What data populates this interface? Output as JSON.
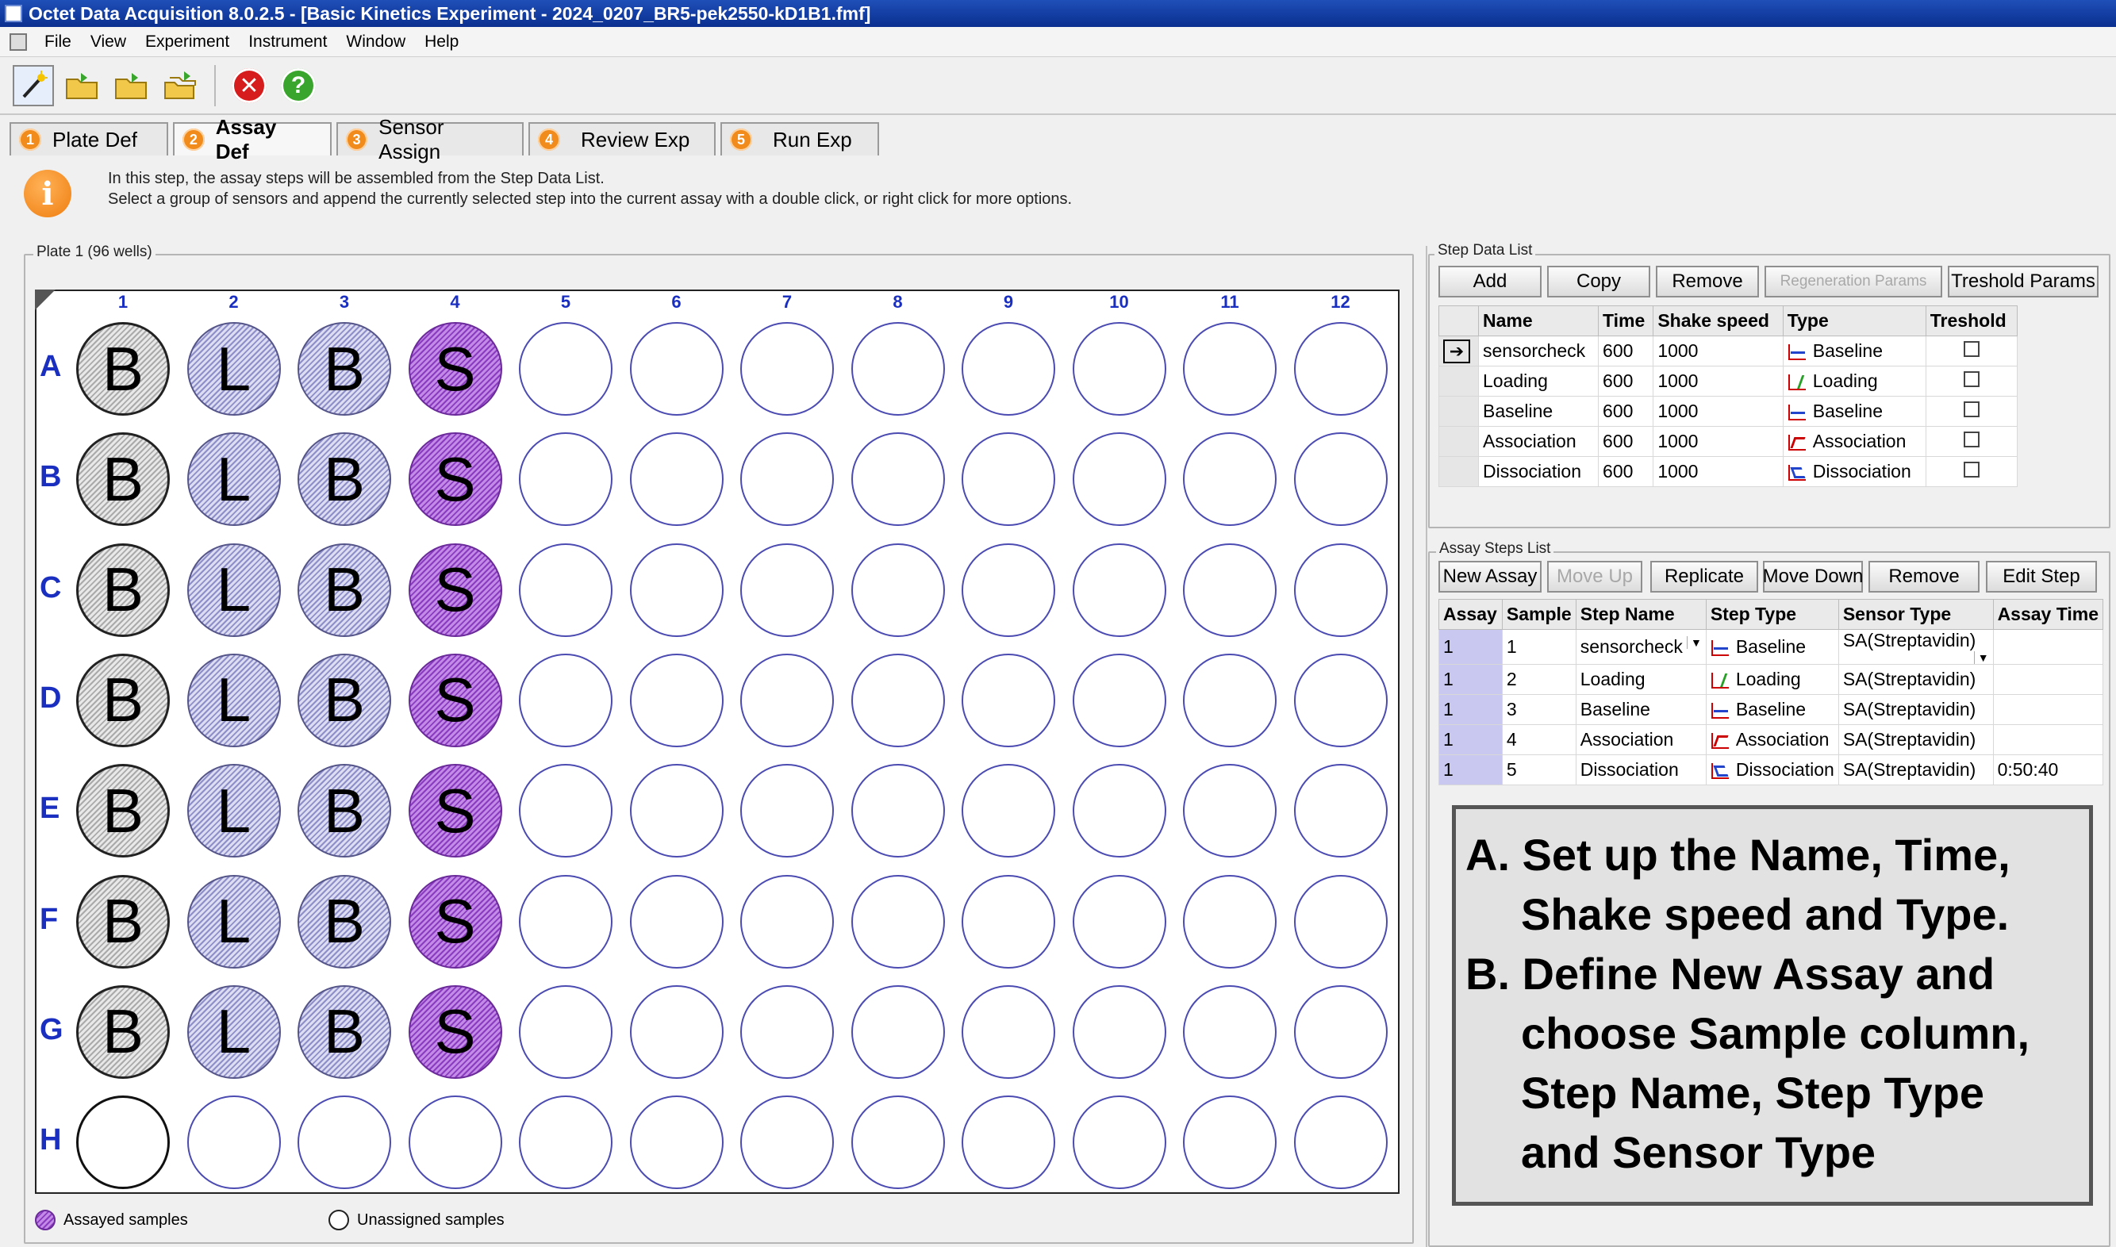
{
  "window": {
    "title": "Octet Data Acquisition 8.0.2.5 - [Basic Kinetics Experiment - 2024_0207_BR5-pek2550-kD1B1.fmf]"
  },
  "menu": [
    "File",
    "View",
    "Experiment",
    "Instrument",
    "Window",
    "Help"
  ],
  "tabs": [
    {
      "num": "1",
      "label": "Plate Def"
    },
    {
      "num": "2",
      "label": "Assay Def"
    },
    {
      "num": "3",
      "label": "Sensor Assign"
    },
    {
      "num": "4",
      "label": "Review Exp"
    },
    {
      "num": "5",
      "label": "Run Exp"
    }
  ],
  "info": {
    "line1": "In this step, the assay steps will be assembled from the Step Data List.",
    "line2": "Select a group of sensors and append the currently selected step into the current assay with a double click, or right click for more options."
  },
  "plate": {
    "group_label": "Plate 1 (96 wells)",
    "columns": [
      "1",
      "2",
      "3",
      "4",
      "5",
      "6",
      "7",
      "8",
      "9",
      "10",
      "11",
      "12"
    ],
    "rows": [
      "A",
      "B",
      "C",
      "D",
      "E",
      "F",
      "G",
      "H"
    ],
    "well_letters": [
      "B",
      "L",
      "B",
      "S"
    ],
    "legend_assayed": "Assayed samples",
    "legend_unassigned": "Unassigned samples"
  },
  "step_data": {
    "group_label": "Step Data List",
    "buttons": [
      "Add",
      "Copy",
      "Remove",
      "Regeneration Params",
      "Treshold Params"
    ],
    "headers": [
      "Name",
      "Time",
      "Shake speed",
      "Type",
      "Treshold"
    ],
    "rows": [
      {
        "name": "sensorcheck",
        "time": "600",
        "speed": "1000",
        "type": "Baseline"
      },
      {
        "name": "Loading",
        "time": "600",
        "speed": "1000",
        "type": "Loading"
      },
      {
        "name": "Baseline",
        "time": "600",
        "speed": "1000",
        "type": "Baseline"
      },
      {
        "name": "Association",
        "time": "600",
        "speed": "1000",
        "type": "Association"
      },
      {
        "name": "Dissociation",
        "time": "600",
        "speed": "1000",
        "type": "Dissociation"
      }
    ]
  },
  "assay_steps": {
    "group_label": "Assay Steps List",
    "buttons": [
      "New Assay",
      "Move Up",
      "Replicate",
      "Move Down",
      "Remove",
      "Edit Step"
    ],
    "headers": [
      "Assay",
      "Sample",
      "Step Name",
      "Step Type",
      "Sensor Type",
      "Assay Time"
    ],
    "rows": [
      {
        "assay": "1",
        "sample": "1",
        "step_name": "sensorcheck",
        "step_type": "Baseline",
        "sensor": "SA(Streptavidin)",
        "time": ""
      },
      {
        "assay": "1",
        "sample": "2",
        "step_name": "Loading",
        "step_type": "Loading",
        "sensor": "SA(Streptavidin)",
        "time": ""
      },
      {
        "assay": "1",
        "sample": "3",
        "step_name": "Baseline",
        "step_type": "Baseline",
        "sensor": "SA(Streptavidin)",
        "time": ""
      },
      {
        "assay": "1",
        "sample": "4",
        "step_name": "Association",
        "step_type": "Association",
        "sensor": "SA(Streptavidin)",
        "time": ""
      },
      {
        "assay": "1",
        "sample": "5",
        "step_name": "Dissociation",
        "step_type": "Dissociation",
        "sensor": "SA(Streptavidin)",
        "time": "0:50:40"
      }
    ]
  },
  "annotation": {
    "a_line1": "A. Set up the Name, Time,",
    "a_line2": "Shake speed and Type.",
    "b_line1": "B. Define New Assay and",
    "b_line2": "choose Sample column,",
    "b_line3": "Step Name, Step Type",
    "b_line4": "and Sensor Type"
  }
}
